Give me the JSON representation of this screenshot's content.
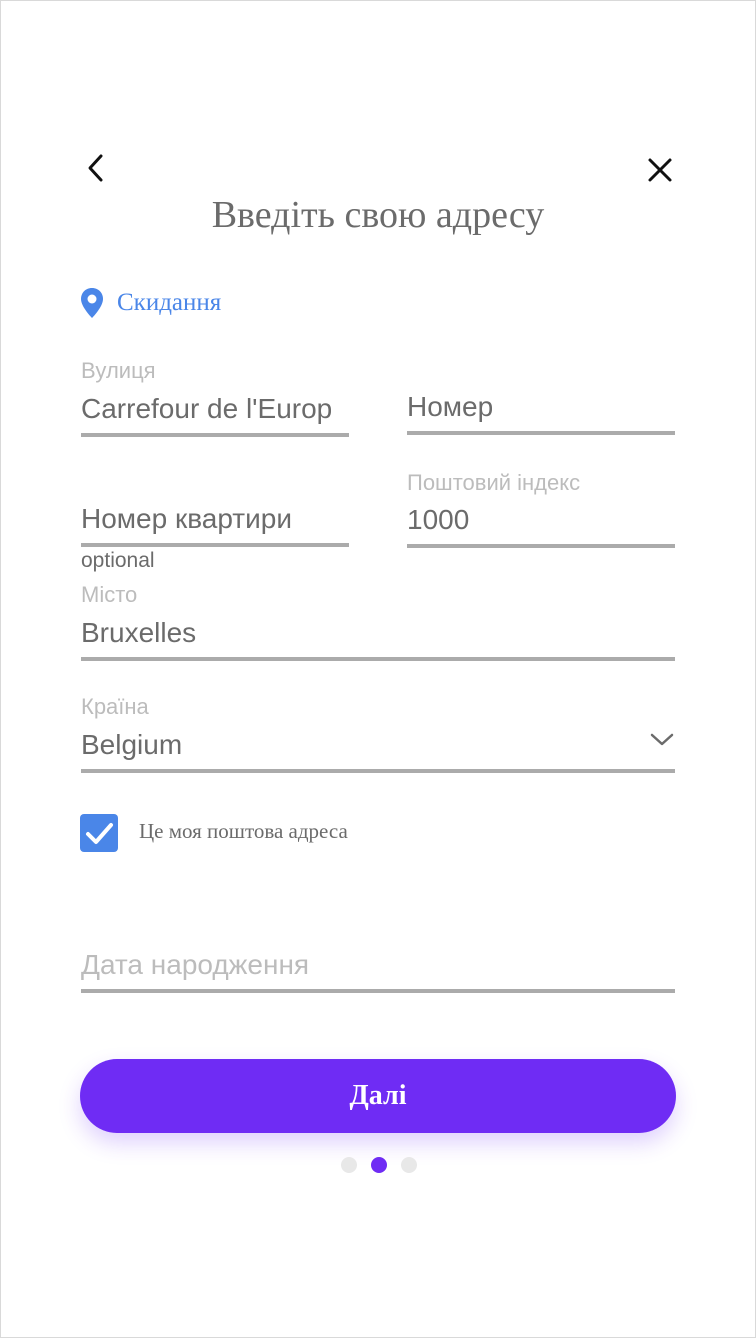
{
  "header": {
    "title": "Введіть свою адресу",
    "back_icon": "chevron-left-icon",
    "close_icon": "close-icon"
  },
  "reset": {
    "label": "Скидання",
    "icon": "map-pin-icon",
    "color": "#4a86e8"
  },
  "form": {
    "street": {
      "label": "Вулиця",
      "value": "Carrefour de l'Europ"
    },
    "number": {
      "placeholder": "Номер"
    },
    "apartment": {
      "placeholder": "Номер квартири",
      "hint": "optional"
    },
    "postal_code": {
      "label": "Поштовий індекс",
      "value": "1000"
    },
    "city": {
      "label": "Місто",
      "value": "Bruxelles"
    },
    "country": {
      "label": "Країна",
      "value": "Belgium",
      "icon": "chevron-down-icon"
    },
    "postal_checkbox": {
      "label": "Це моя поштова адреса",
      "checked": true
    },
    "birth_date": {
      "placeholder": "Дата народження"
    }
  },
  "next_button": {
    "label": "Далі",
    "color": "#6f2cf4"
  },
  "pagination": {
    "total": 3,
    "active_index": 1
  }
}
